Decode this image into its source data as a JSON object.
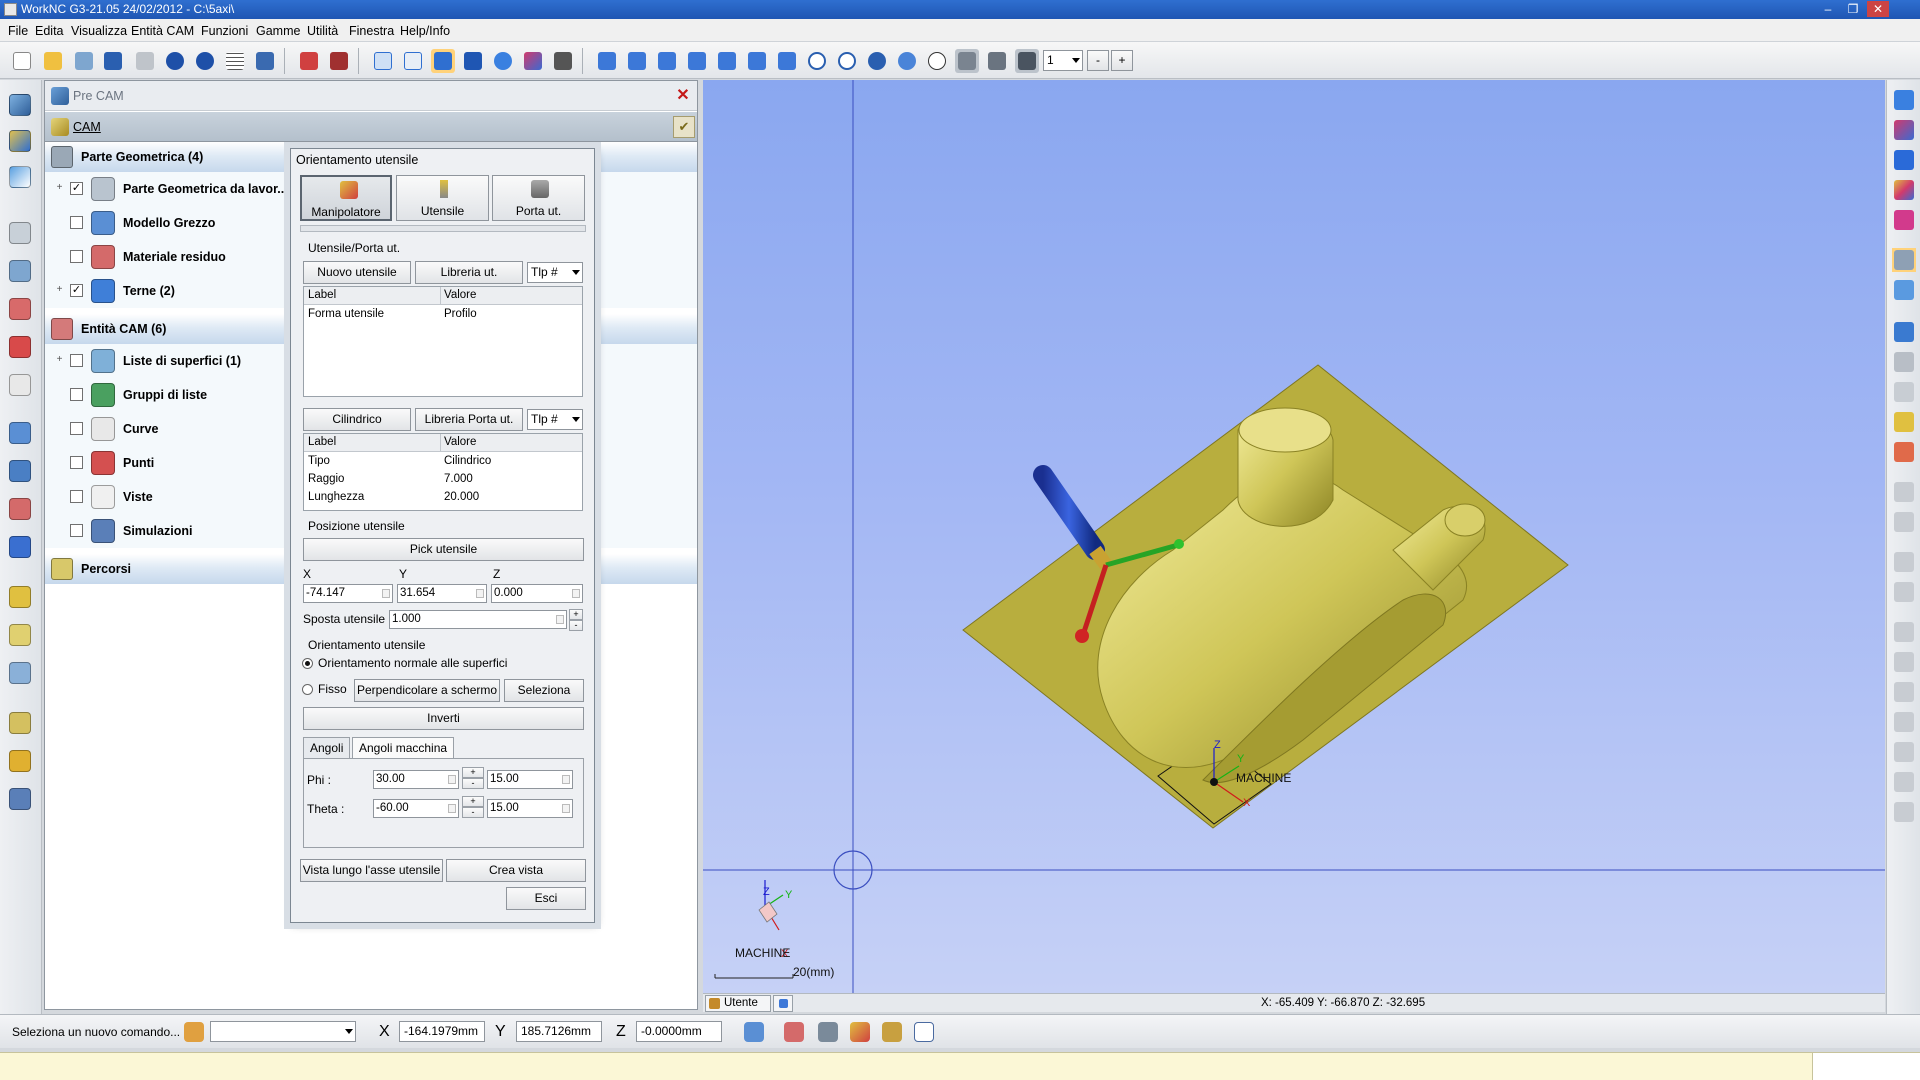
{
  "window": {
    "title": "WorkNC G3-21.05 24/02/2012 - C:\\5axi\\",
    "controls": [
      "–",
      "❐",
      "✕"
    ]
  },
  "menu": [
    "File",
    "Edita",
    "Visualizza",
    "Entità CAM",
    "Funzioni",
    "Gamme",
    "Utilità",
    "Finestra",
    "Help/Info"
  ],
  "toolbar": {
    "view_number": "1",
    "minus_label": "-",
    "plus_label": "+"
  },
  "panel": {
    "header": "Pre CAM",
    "cam_label": "CAM",
    "sections": [
      {
        "label": "Parte Geometrica (4)",
        "color": "#9aa8b6",
        "items": [
          {
            "label": "Parte Geometrica da lavor...",
            "checked": true,
            "expandable": true,
            "icon": "geometry-icon",
            "color": "#b9c4cf"
          },
          {
            "label": "Modello Grezzo",
            "checked": false,
            "expandable": false,
            "icon": "stock-model-icon",
            "color": "#5a8fd4"
          },
          {
            "label": "Materiale residuo",
            "checked": false,
            "expandable": false,
            "icon": "residual-material-icon",
            "color": "#d46a6a"
          },
          {
            "label": "Terne (2)",
            "checked": true,
            "expandable": true,
            "icon": "frames-icon",
            "color": "#3f7fd8"
          }
        ]
      },
      {
        "label": "Entità CAM (6)",
        "color": "#d47a7a",
        "items": [
          {
            "label": "Liste di superfici (1)",
            "checked": false,
            "expandable": true,
            "icon": "surface-lists-icon",
            "color": "#7fb0d8"
          },
          {
            "label": "Gruppi di liste",
            "checked": false,
            "expandable": false,
            "icon": "list-groups-icon",
            "color": "#4aa060"
          },
          {
            "label": "Curve",
            "checked": false,
            "expandable": false,
            "icon": "curves-icon",
            "color": "#e8e8e8"
          },
          {
            "label": "Punti",
            "checked": false,
            "expandable": false,
            "icon": "points-icon",
            "color": "#d45050"
          },
          {
            "label": "Viste",
            "checked": false,
            "expandable": false,
            "icon": "views-icon",
            "color": "#f0f0f0"
          },
          {
            "label": "Simulazioni",
            "checked": false,
            "expandable": false,
            "icon": "simulations-icon",
            "color": "#5a7fb8"
          }
        ]
      },
      {
        "label": "Percorsi",
        "color": "#d8c86a",
        "items": []
      }
    ]
  },
  "dialog": {
    "title": "Orientamento utensile",
    "tabs": [
      {
        "label": "Manipolatore",
        "active": true
      },
      {
        "label": "Utensile",
        "active": false
      },
      {
        "label": "Porta ut.",
        "active": false
      }
    ],
    "tool_group": {
      "label": "Utensile/Porta ut.",
      "new_tool": "Nuovo utensile",
      "library": "Libreria ut.",
      "type_select": "Tlp #",
      "grid_headers": [
        "Label",
        "Valore"
      ],
      "grid_rows": [
        [
          "Forma utensile",
          "Profilo"
        ]
      ]
    },
    "holder_group": {
      "name": "Cilindrico",
      "library": "Libreria Porta ut.",
      "type_select": "Tlp #",
      "grid_headers": [
        "Label",
        "Valore"
      ],
      "grid_rows": [
        [
          "Tipo",
          "Cilindrico"
        ],
        [
          "Raggio",
          "7.000"
        ],
        [
          "Lunghezza",
          "20.000"
        ]
      ]
    },
    "position_group": {
      "label": "Posizione utensile",
      "pick": "Pick utensile",
      "x_label": "X",
      "y_label": "Y",
      "z_label": "Z",
      "x": "-74.147",
      "y": "31.654",
      "z": "0.000",
      "shift_label": "Sposta utensile :",
      "shift": "1.000"
    },
    "orientation_group": {
      "label": "Orientamento utensile",
      "normal_label": "Orientamento normale alle superfici",
      "fixed_label": "Fisso",
      "perpendicular": "Perpendicolare a schermo",
      "select": "Seleziona",
      "invert": "Inverti"
    },
    "angle_tabs": [
      {
        "label": "Angoli",
        "active": true
      },
      {
        "label": "Angoli macchina",
        "active": false
      }
    ],
    "phi_label": "Phi :",
    "phi": "30.00",
    "phi_step": "15.00",
    "theta_label": "Theta :",
    "theta": "-60.00",
    "theta_step": "15.00",
    "step_plus": "+",
    "step_minus": "-",
    "view_along_axis": "Vista lungo l'asse utensile",
    "create_view": "Crea vista",
    "exit": "Esci"
  },
  "viewport": {
    "part_label": "MACHINE",
    "axis_z": "Z",
    "axis_y": "Y",
    "axis_x": "X",
    "triad_label": "MACHINE",
    "scale_label": "20(mm)",
    "tab_label": "Utente",
    "coords": "X: -65.409   Y: -66.870   Z: -32.695",
    "colors": {
      "background_top": "#8aa7f0",
      "part": "#c9c25a",
      "plate": "#b8ae3e",
      "tool_holder": "#1c3ea8"
    }
  },
  "command_bar": {
    "prompt": "Seleziona un nuovo comando...",
    "x_label": "X",
    "x": "-164.1979mm",
    "y_label": "Y",
    "y": "185.7126mm",
    "z_label": "Z",
    "z": "-0.0000mm"
  }
}
